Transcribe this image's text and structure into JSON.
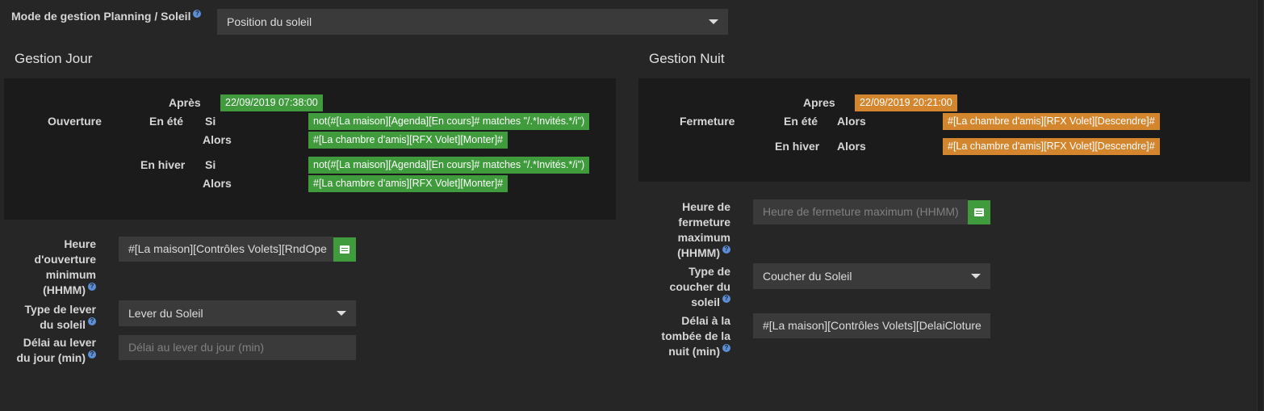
{
  "mode": {
    "label": "Mode de gestion Planning / Soleil",
    "value": "Position du soleil"
  },
  "day": {
    "title": "Gestion Jour",
    "ouverture_label": "Ouverture",
    "apres_label": "Après",
    "apres_value": "22/09/2019 07:38:00",
    "ete_label": "En été",
    "hiver_label": "En hiver",
    "si_label": "Si",
    "alors_label": "Alors",
    "ete_si": "not(#[La maison][Agenda][En cours]# matches \"/.*Invités.*/i\")",
    "ete_alors": "#[La chambre d'amis][RFX Volet][Monter]#",
    "hiver_si": "not(#[La maison][Agenda][En cours]# matches \"/.*Invités.*/i\")",
    "hiver_alors": "#[La chambre d'amis][RFX Volet][Monter]#",
    "heure_label_1": "Heure",
    "heure_label_2": "d'ouverture",
    "heure_label_3": "minimum",
    "heure_label_4": "(HHMM)",
    "heure_value": "#[La maison][Contrôles Volets][RndOpe",
    "type_label_1": "Type de lever",
    "type_label_2": "du soleil",
    "type_value": "Lever du Soleil",
    "delai_label_1": "Délai au lever",
    "delai_label_2": "du jour (min)",
    "delai_placeholder": "Délai au lever du jour (min)"
  },
  "night": {
    "title": "Gestion Nuit",
    "fermeture_label": "Fermeture",
    "apres_label": "Apres",
    "apres_value": "22/09/2019 20:21:00",
    "ete_label": "En été",
    "hiver_label": "En hiver",
    "alors_label": "Alors",
    "ete_alors": "#[La chambre d'amis][RFX Volet][Descendre]#",
    "hiver_alors": "#[La chambre d'amis][RFX Volet][Descendre]#",
    "heure_label_1": "Heure de",
    "heure_label_2": "fermeture",
    "heure_label_3": "maximum",
    "heure_label_4": "(HHMM)",
    "heure_placeholder": "Heure de fermeture maximum (HHMM)",
    "type_label_1": "Type de",
    "type_label_2": "coucher du",
    "type_label_3": "soleil",
    "type_value": "Coucher du Soleil",
    "delai_label_1": "Délai à la",
    "delai_label_2": "tombée de la",
    "delai_label_3": "nuit (min)",
    "delai_value": "#[La maison][Contrôles Volets][DelaiCloture"
  },
  "icons": {
    "help": "?",
    "help_icon": "question-circle-icon",
    "list_icon": "list-alt-icon",
    "caret_icon": "caret-down-icon"
  },
  "colors": {
    "green": "#3f9b3c",
    "orange": "#d4862f",
    "help": "#5b8fd9"
  }
}
